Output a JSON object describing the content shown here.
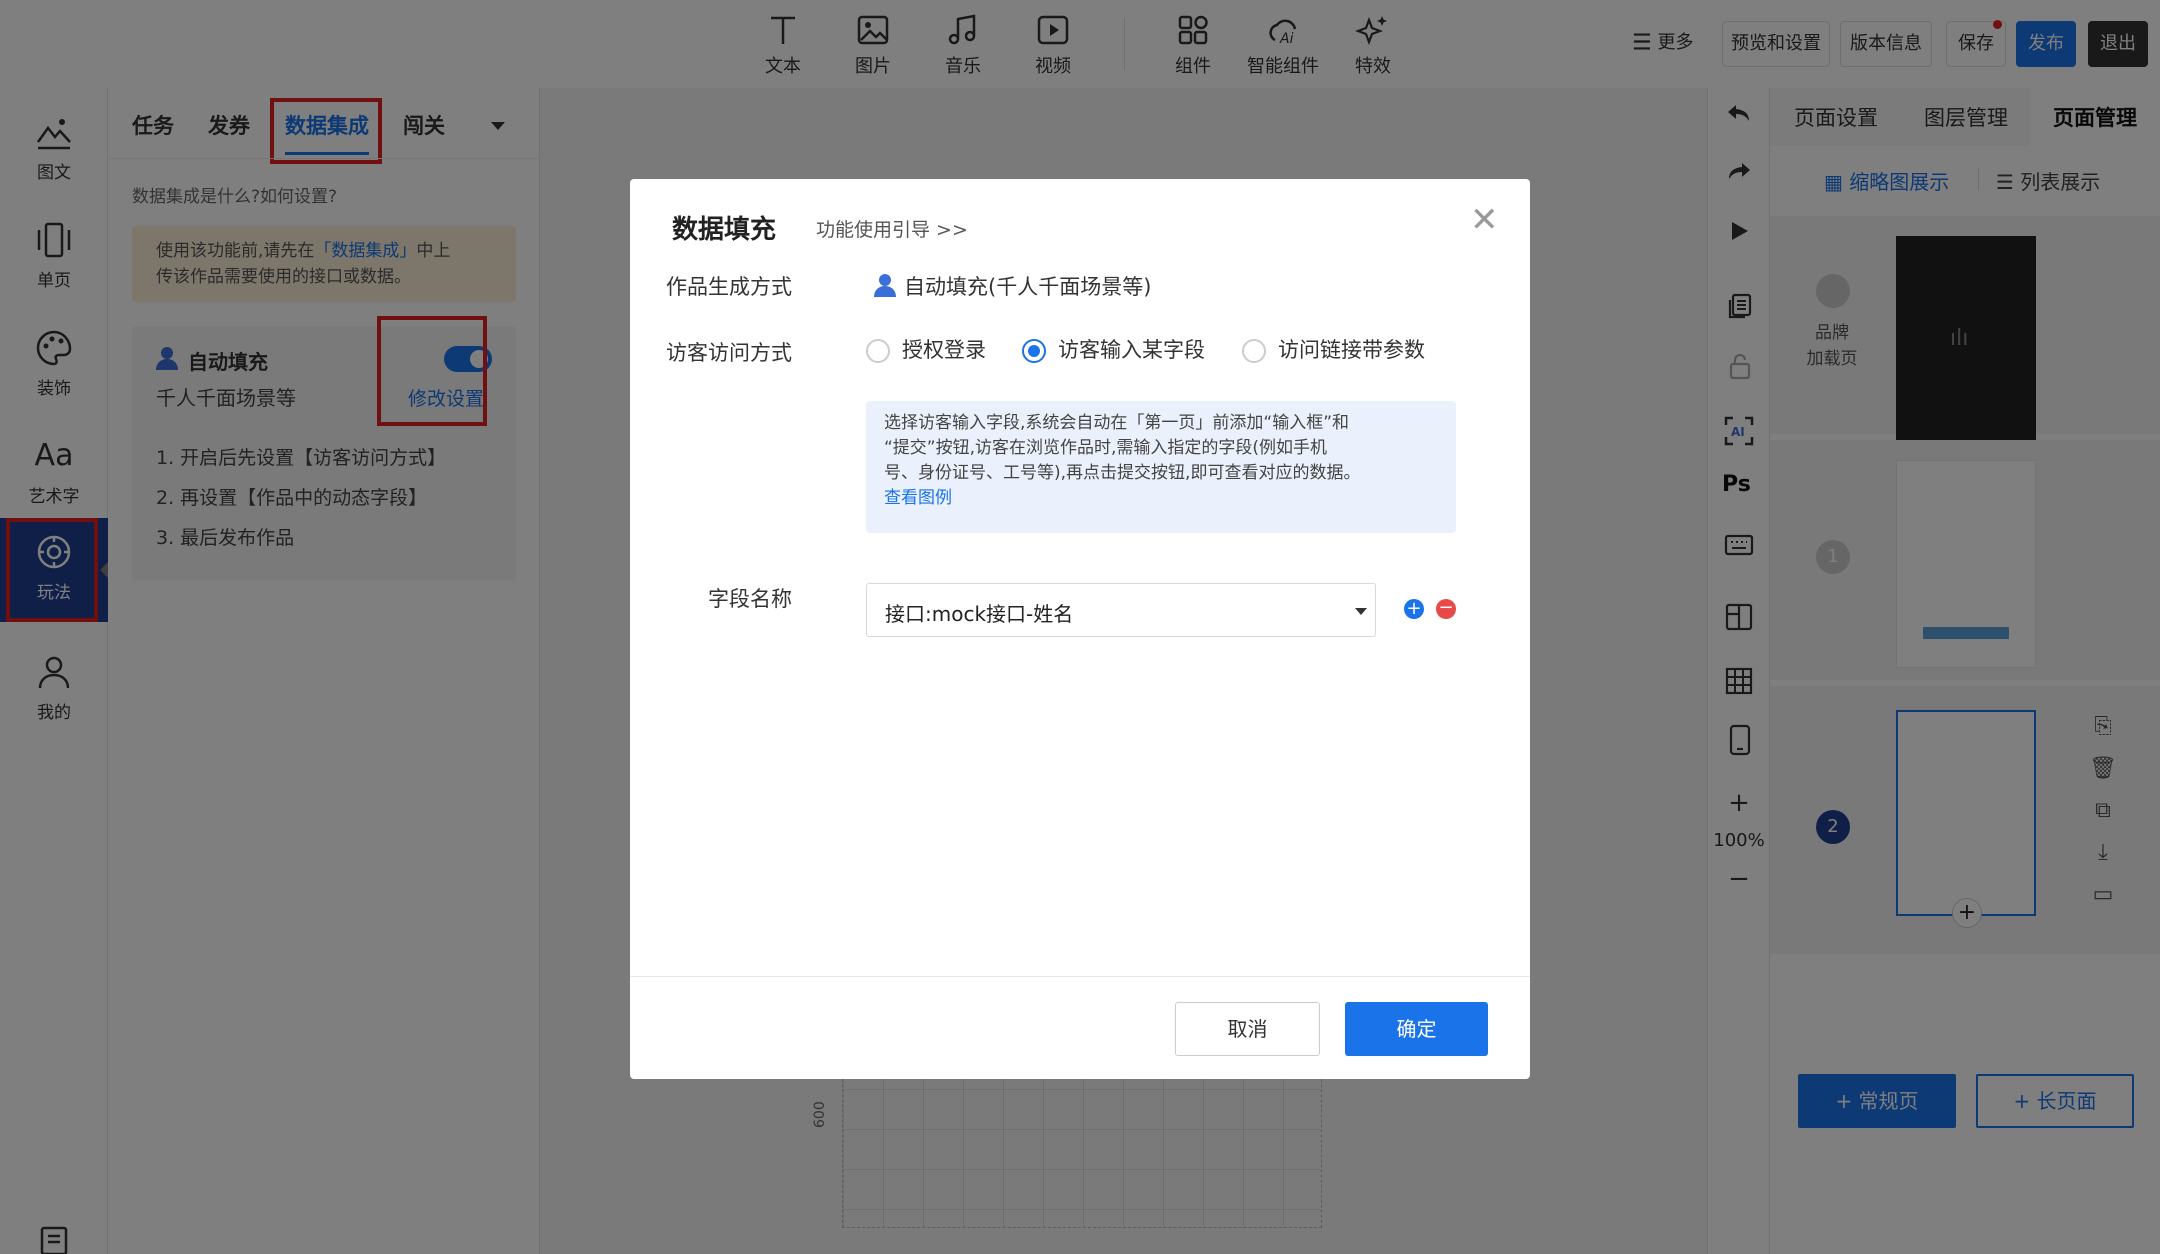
{
  "toolbar": {
    "tools": [
      {
        "label": "文本",
        "icon": "text-icon"
      },
      {
        "label": "图片",
        "icon": "image-icon"
      },
      {
        "label": "音乐",
        "icon": "music-icon"
      },
      {
        "label": "视频",
        "icon": "video-icon"
      },
      {
        "label": "组件",
        "icon": "components-icon"
      },
      {
        "label": "智能组件",
        "icon": "ai-components-icon"
      },
      {
        "label": "特效",
        "icon": "sparkle-icon"
      }
    ],
    "more": "更多",
    "preview": "预览和设置",
    "version": "版本信息",
    "save": "保存",
    "publish": "发布",
    "exit": "退出"
  },
  "rail": {
    "items": [
      {
        "label": "图文",
        "icon": "image-text-icon"
      },
      {
        "label": "单页",
        "icon": "single-page-icon"
      },
      {
        "label": "装饰",
        "icon": "palette-icon"
      },
      {
        "label": "艺术字",
        "icon": "art-text-icon"
      },
      {
        "label": "玩法",
        "icon": "gameplay-icon"
      },
      {
        "label": "我的",
        "icon": "user-icon"
      }
    ]
  },
  "left_panel": {
    "tabs": [
      "任务",
      "发券",
      "数据集成",
      "闯关"
    ],
    "help_link": "数据集成是什么?如何设置?",
    "notice_line1_pre": "使用该功能前,请先在",
    "notice_link": "「数据集成」",
    "notice_line1_post": "中上",
    "notice_line2": "传该作品需要使用的接口或数据。",
    "card_title": "自动填充",
    "card_subtitle": "千人千面场景等",
    "card_action": "修改设置",
    "steps": [
      "1. 开启后先设置【访客访问方式】",
      "2. 再设置【作品中的动态字段】",
      "3. 最后发布作品"
    ]
  },
  "canvas": {
    "ruler_label": "600"
  },
  "right_tools": {
    "ps_label": "Ps",
    "zoom": "100%"
  },
  "right_panel": {
    "tabs": [
      "页面设置",
      "图层管理",
      "页面管理"
    ],
    "view_thumb": "缩略图展示",
    "view_list": "列表展示",
    "brand_label_1": "品牌",
    "brand_label_2": "加载页",
    "page1_num": "1",
    "page2_num": "2",
    "btn_normal": "+ 常规页",
    "btn_long": "+ 长页面"
  },
  "modal": {
    "title": "数据填充",
    "guide": "功能使用引导 >>",
    "gen_label": "作品生成方式",
    "gen_value": "自动填充(千人千面场景等)",
    "access_label": "访客访问方式",
    "access_options": [
      "授权登录",
      "访客输入某字段",
      "访问链接带参数"
    ],
    "access_selected": 1,
    "info_line1": "选择访客输入字段,系统会自动在「第一页」前添加“输入框”和",
    "info_line2": "“提交”按钮,访客在浏览作品时,需输入指定的字段(例如手机",
    "info_line3": "号、身份证号、工号等),再点击提交按钮,即可查看对应的数据。",
    "info_link": "查看图例",
    "field_label": "字段名称",
    "field_value": "接口:mock接口-姓名",
    "cancel": "取消",
    "confirm": "确定"
  },
  "colors": {
    "accent": "#1a73e8",
    "highlight": "#e02020",
    "notice_bg": "#fbefd6"
  }
}
